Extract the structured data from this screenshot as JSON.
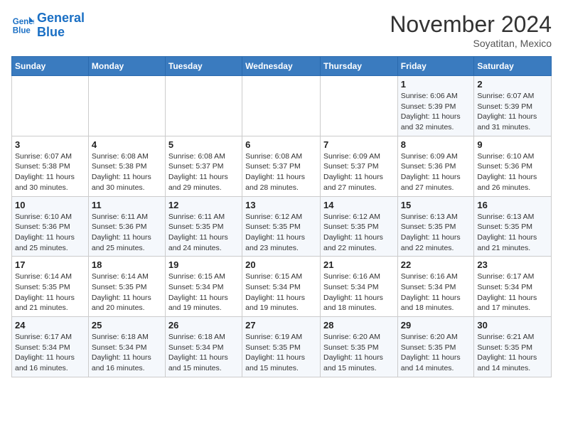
{
  "header": {
    "logo_line1": "General",
    "logo_line2": "Blue",
    "month": "November 2024",
    "location": "Soyatitan, Mexico"
  },
  "weekdays": [
    "Sunday",
    "Monday",
    "Tuesday",
    "Wednesday",
    "Thursday",
    "Friday",
    "Saturday"
  ],
  "weeks": [
    [
      {
        "day": "",
        "info": ""
      },
      {
        "day": "",
        "info": ""
      },
      {
        "day": "",
        "info": ""
      },
      {
        "day": "",
        "info": ""
      },
      {
        "day": "",
        "info": ""
      },
      {
        "day": "1",
        "info": "Sunrise: 6:06 AM\nSunset: 5:39 PM\nDaylight: 11 hours and 32 minutes."
      },
      {
        "day": "2",
        "info": "Sunrise: 6:07 AM\nSunset: 5:39 PM\nDaylight: 11 hours and 31 minutes."
      }
    ],
    [
      {
        "day": "3",
        "info": "Sunrise: 6:07 AM\nSunset: 5:38 PM\nDaylight: 11 hours and 30 minutes."
      },
      {
        "day": "4",
        "info": "Sunrise: 6:08 AM\nSunset: 5:38 PM\nDaylight: 11 hours and 30 minutes."
      },
      {
        "day": "5",
        "info": "Sunrise: 6:08 AM\nSunset: 5:37 PM\nDaylight: 11 hours and 29 minutes."
      },
      {
        "day": "6",
        "info": "Sunrise: 6:08 AM\nSunset: 5:37 PM\nDaylight: 11 hours and 28 minutes."
      },
      {
        "day": "7",
        "info": "Sunrise: 6:09 AM\nSunset: 5:37 PM\nDaylight: 11 hours and 27 minutes."
      },
      {
        "day": "8",
        "info": "Sunrise: 6:09 AM\nSunset: 5:36 PM\nDaylight: 11 hours and 27 minutes."
      },
      {
        "day": "9",
        "info": "Sunrise: 6:10 AM\nSunset: 5:36 PM\nDaylight: 11 hours and 26 minutes."
      }
    ],
    [
      {
        "day": "10",
        "info": "Sunrise: 6:10 AM\nSunset: 5:36 PM\nDaylight: 11 hours and 25 minutes."
      },
      {
        "day": "11",
        "info": "Sunrise: 6:11 AM\nSunset: 5:36 PM\nDaylight: 11 hours and 25 minutes."
      },
      {
        "day": "12",
        "info": "Sunrise: 6:11 AM\nSunset: 5:35 PM\nDaylight: 11 hours and 24 minutes."
      },
      {
        "day": "13",
        "info": "Sunrise: 6:12 AM\nSunset: 5:35 PM\nDaylight: 11 hours and 23 minutes."
      },
      {
        "day": "14",
        "info": "Sunrise: 6:12 AM\nSunset: 5:35 PM\nDaylight: 11 hours and 22 minutes."
      },
      {
        "day": "15",
        "info": "Sunrise: 6:13 AM\nSunset: 5:35 PM\nDaylight: 11 hours and 22 minutes."
      },
      {
        "day": "16",
        "info": "Sunrise: 6:13 AM\nSunset: 5:35 PM\nDaylight: 11 hours and 21 minutes."
      }
    ],
    [
      {
        "day": "17",
        "info": "Sunrise: 6:14 AM\nSunset: 5:35 PM\nDaylight: 11 hours and 21 minutes."
      },
      {
        "day": "18",
        "info": "Sunrise: 6:14 AM\nSunset: 5:35 PM\nDaylight: 11 hours and 20 minutes."
      },
      {
        "day": "19",
        "info": "Sunrise: 6:15 AM\nSunset: 5:34 PM\nDaylight: 11 hours and 19 minutes."
      },
      {
        "day": "20",
        "info": "Sunrise: 6:15 AM\nSunset: 5:34 PM\nDaylight: 11 hours and 19 minutes."
      },
      {
        "day": "21",
        "info": "Sunrise: 6:16 AM\nSunset: 5:34 PM\nDaylight: 11 hours and 18 minutes."
      },
      {
        "day": "22",
        "info": "Sunrise: 6:16 AM\nSunset: 5:34 PM\nDaylight: 11 hours and 18 minutes."
      },
      {
        "day": "23",
        "info": "Sunrise: 6:17 AM\nSunset: 5:34 PM\nDaylight: 11 hours and 17 minutes."
      }
    ],
    [
      {
        "day": "24",
        "info": "Sunrise: 6:17 AM\nSunset: 5:34 PM\nDaylight: 11 hours and 16 minutes."
      },
      {
        "day": "25",
        "info": "Sunrise: 6:18 AM\nSunset: 5:34 PM\nDaylight: 11 hours and 16 minutes."
      },
      {
        "day": "26",
        "info": "Sunrise: 6:18 AM\nSunset: 5:34 PM\nDaylight: 11 hours and 15 minutes."
      },
      {
        "day": "27",
        "info": "Sunrise: 6:19 AM\nSunset: 5:35 PM\nDaylight: 11 hours and 15 minutes."
      },
      {
        "day": "28",
        "info": "Sunrise: 6:20 AM\nSunset: 5:35 PM\nDaylight: 11 hours and 15 minutes."
      },
      {
        "day": "29",
        "info": "Sunrise: 6:20 AM\nSunset: 5:35 PM\nDaylight: 11 hours and 14 minutes."
      },
      {
        "day": "30",
        "info": "Sunrise: 6:21 AM\nSunset: 5:35 PM\nDaylight: 11 hours and 14 minutes."
      }
    ]
  ]
}
